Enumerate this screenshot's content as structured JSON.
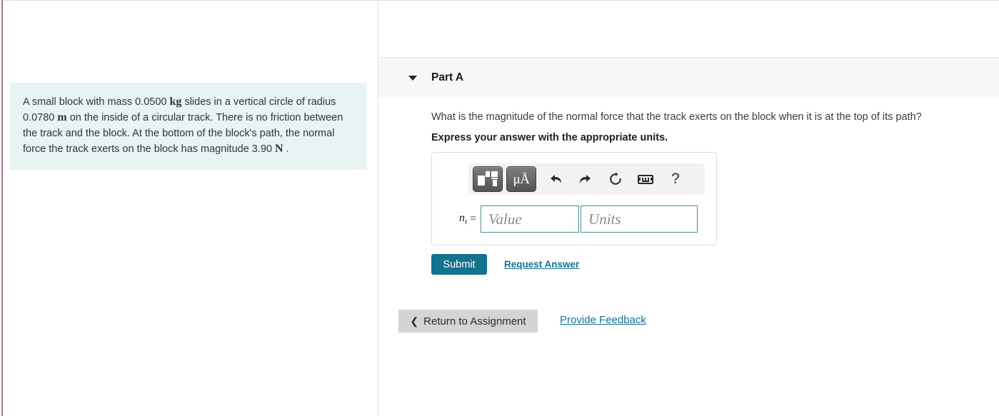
{
  "theme": {
    "accent_teal": "#12738f",
    "problem_bg": "#e8f4f4",
    "header_bg": "#f7f7f7",
    "left_accent": "#a8737f",
    "input_border": "#4c8b94"
  },
  "problem": {
    "text_part1": "A small block with mass 0.0500 ",
    "unit_kg": "kg",
    "text_part2": " slides in a vertical circle of radius 0.0780 ",
    "unit_m": "m",
    "text_part3": " on the inside of a circular track. There is no friction between the track and the block. At the bottom of the block's path, the normal force the track exerts on the block has magnitude 3.90 ",
    "unit_N": "N",
    "text_part4": " ."
  },
  "part": {
    "title": "Part A",
    "toggle_icon": "triangle-down-icon",
    "question": "What is the magnitude of the normal force that the track exerts on the block when it is at the top of its path?",
    "instruction": "Express your answer with the appropriate units."
  },
  "toolbar": {
    "buttons": [
      {
        "name": "math-template-button",
        "icon": "math-template-icon",
        "label": ""
      },
      {
        "name": "units-button",
        "icon": "micro-angstrom-icon",
        "label": "μÅ"
      },
      {
        "name": "undo-button",
        "icon": "undo-arrow-icon",
        "label": "↰"
      },
      {
        "name": "redo-button",
        "icon": "redo-arrow-icon",
        "label": "↱"
      },
      {
        "name": "reset-button",
        "icon": "refresh-circle-icon",
        "label": "↻"
      },
      {
        "name": "keyboard-button",
        "icon": "keyboard-icon",
        "label": ""
      },
      {
        "name": "help-button",
        "icon": "question-mark-icon",
        "label": "?"
      }
    ],
    "units_glyph": "μÅ",
    "undo_glyph": "↰",
    "redo_glyph": "↱",
    "reset_glyph": "↻",
    "help_glyph": "?"
  },
  "answer": {
    "variable": "n",
    "variable_subscript": "t",
    "equals": "=",
    "value_placeholder": "Value",
    "value_current": "",
    "units_placeholder": "Units",
    "units_current": ""
  },
  "actions": {
    "submit_label": "Submit",
    "request_answer_label": "Request Answer",
    "return_label": "Return to Assignment",
    "return_chevron": "❮",
    "provide_feedback_label": "Provide Feedback"
  }
}
